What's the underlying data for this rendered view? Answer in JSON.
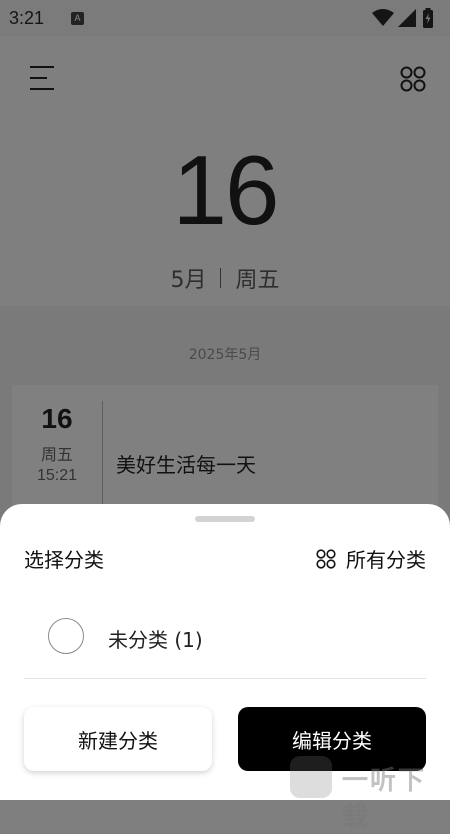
{
  "status_bar": {
    "time": "3:21",
    "notification_icon": "A"
  },
  "header": {
    "menu_icon": "menu-icon",
    "grid_icon": "grid-icon",
    "day": "16",
    "month": "5月",
    "weekday": "周五"
  },
  "list": {
    "group_label": "2025年5月",
    "entries": [
      {
        "day": "16",
        "weekday": "周五",
        "time": "15:21",
        "title": "美好生活每一天"
      }
    ]
  },
  "sheet": {
    "title": "选择分类",
    "all_categories_label": "所有分类",
    "categories": [
      {
        "label": "未分类 (1)",
        "selected": false
      }
    ],
    "new_button": "新建分类",
    "edit_button": "编辑分类"
  },
  "watermark": {
    "text": "一听下载"
  }
}
